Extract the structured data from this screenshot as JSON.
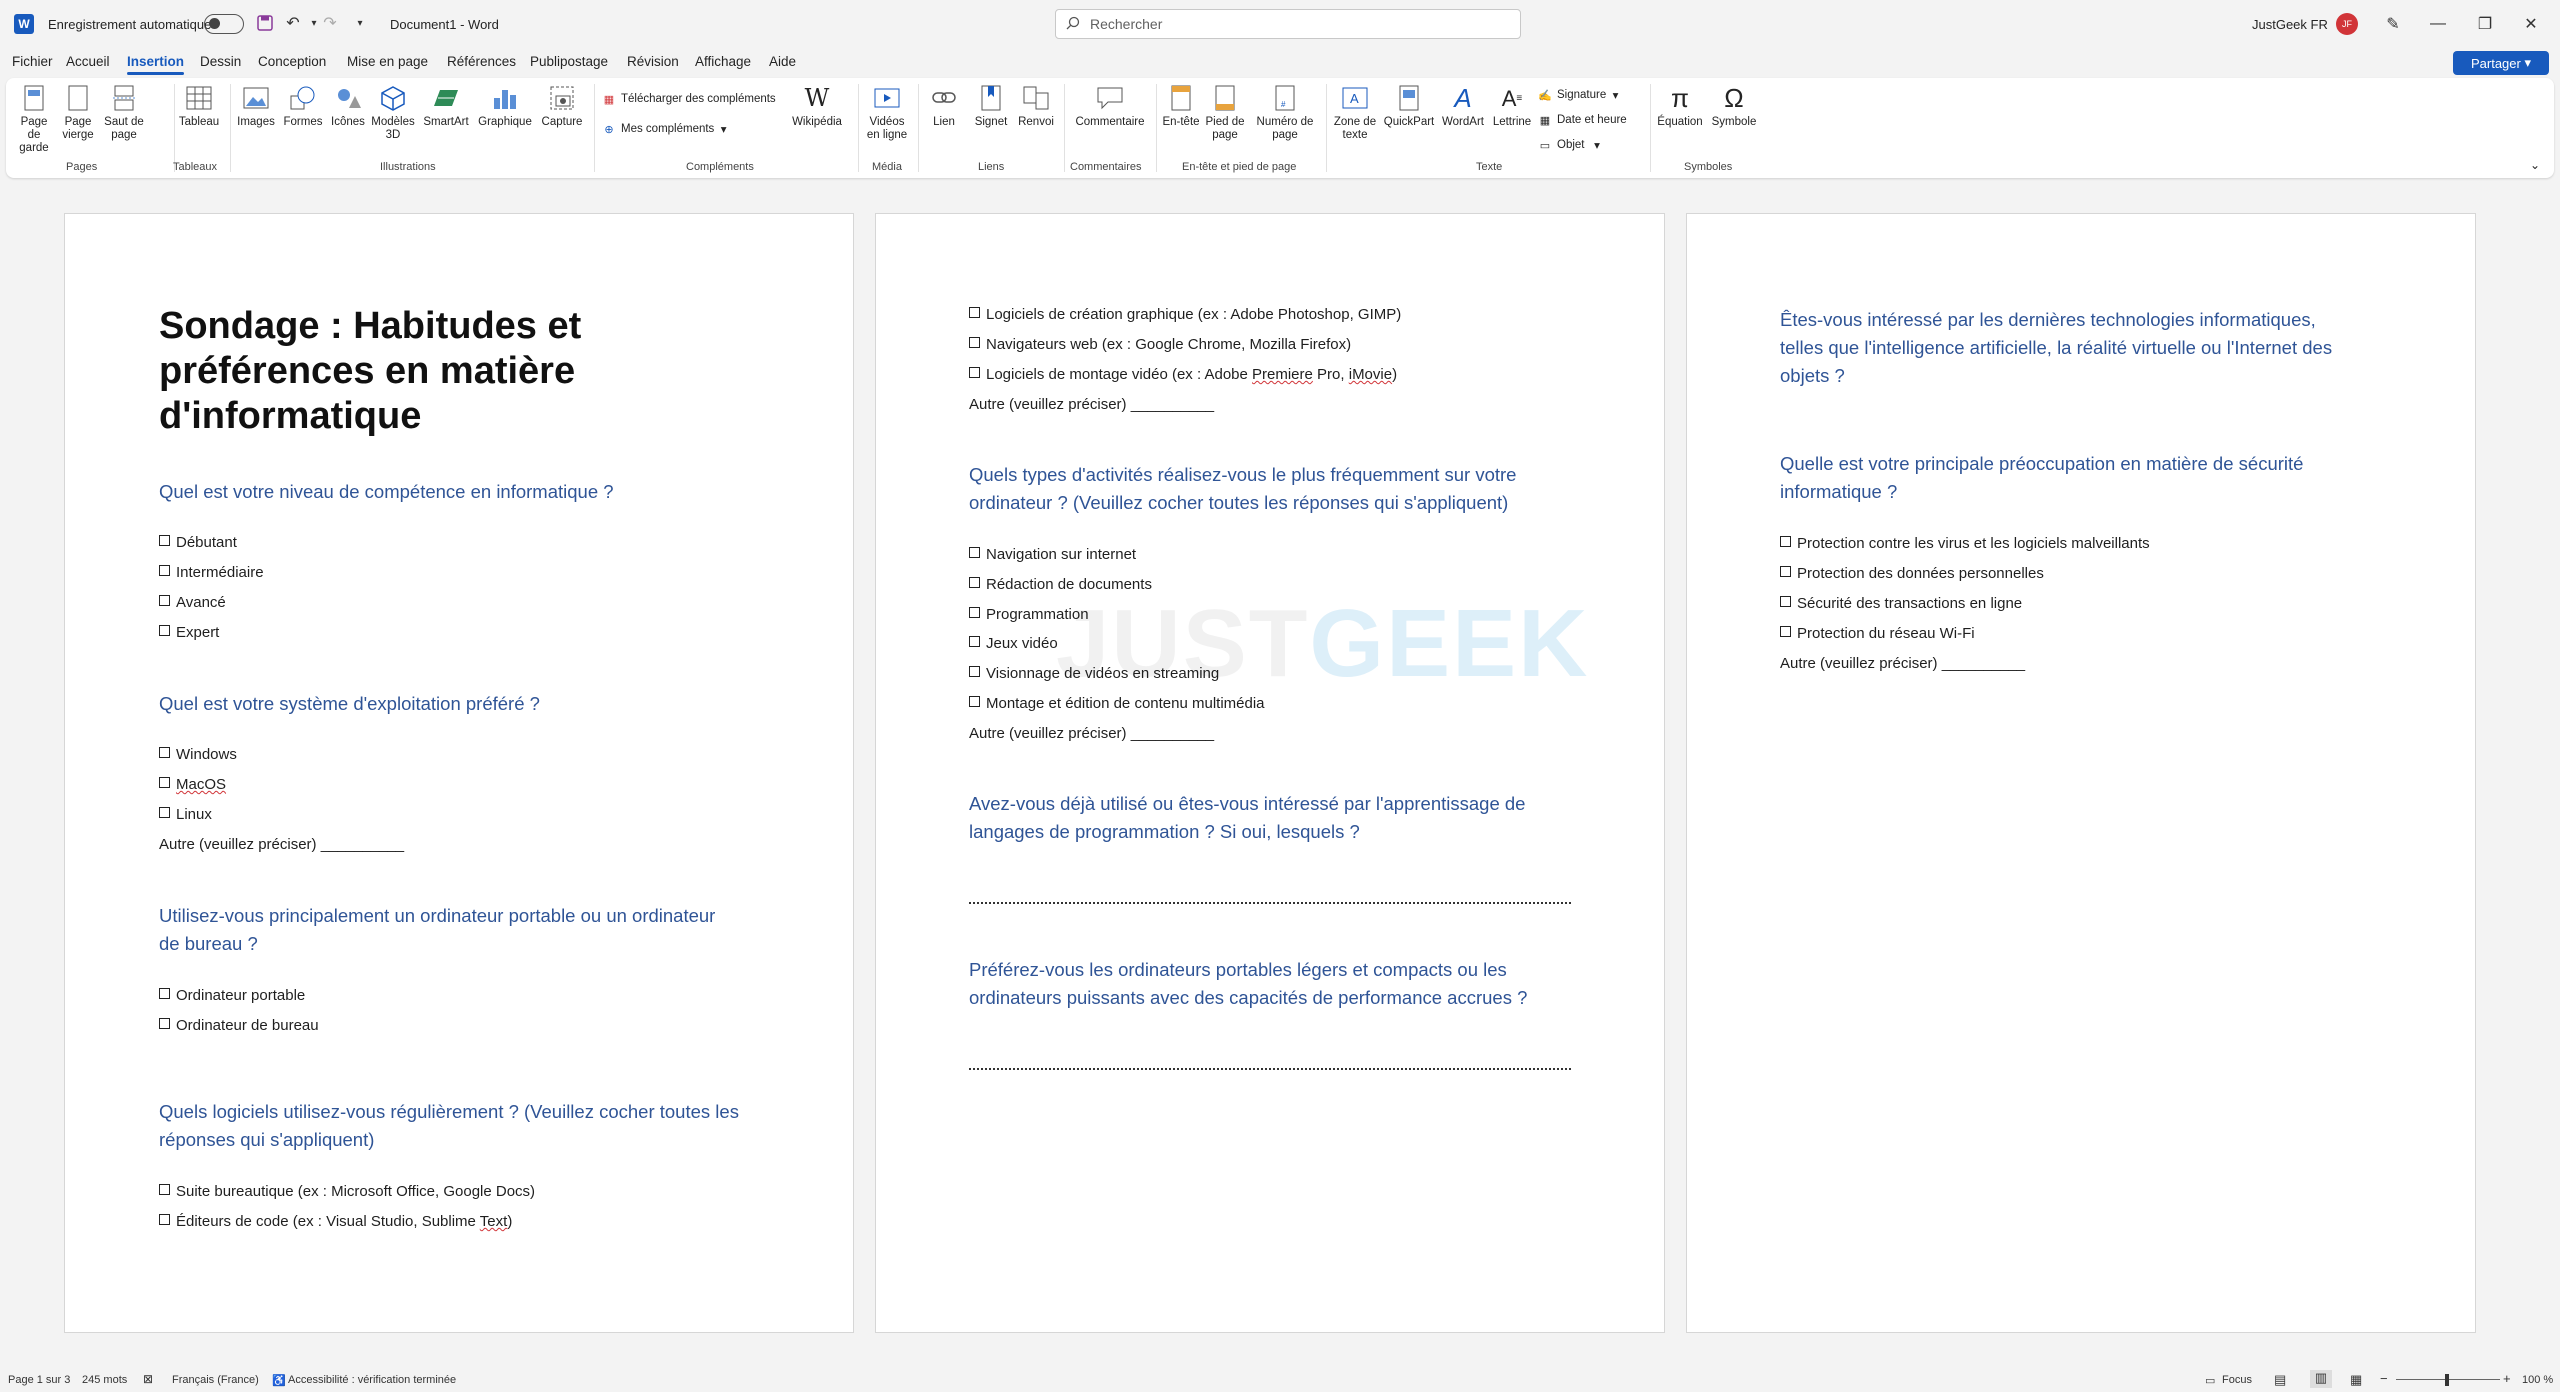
{
  "titlebar": {
    "autosave_label": "Enregistrement automatique",
    "doc_title": "Document1  -  Word",
    "search_placeholder": "Rechercher",
    "account_name": "JustGeek FR",
    "account_initials": "JF"
  },
  "menu": {
    "tabs": [
      "Fichier",
      "Accueil",
      "Insertion",
      "Dessin",
      "Conception",
      "Mise en page",
      "Références",
      "Publipostage",
      "Révision",
      "Affichage",
      "Aide"
    ],
    "active": "Insertion",
    "share_label": "Partager"
  },
  "ribbon": {
    "pages": {
      "page_de_garde": "Page de garde",
      "page_vierge": "Page vierge",
      "saut_de_page": "Saut de page",
      "group": "Pages"
    },
    "tableaux": {
      "tableau": "Tableau",
      "group": "Tableaux"
    },
    "illustrations": {
      "images": "Images",
      "formes": "Formes",
      "icones": "Icônes",
      "modeles3d": "Modèles 3D",
      "smartart": "SmartArt",
      "graphique": "Graphique",
      "capture": "Capture",
      "group": "Illustrations"
    },
    "complements": {
      "telecharger": "Télécharger des compléments",
      "mes": "Mes compléments",
      "wikipedia": "Wikipédia",
      "group": "Compléments"
    },
    "media": {
      "videos": "Vidéos en ligne",
      "group": "Média"
    },
    "liens": {
      "lien": "Lien",
      "signet": "Signet",
      "renvoi": "Renvoi",
      "group": "Liens"
    },
    "commentaires": {
      "commentaire": "Commentaire",
      "group": "Commentaires"
    },
    "entete": {
      "entete": "En-tête",
      "pied": "Pied de page",
      "numero": "Numéro de page",
      "group": "En-tête et pied de page"
    },
    "texte": {
      "zone": "Zone de texte",
      "quickpart": "QuickPart",
      "wordart": "WordArt",
      "lettrine": "Lettrine",
      "signature": "Signature",
      "date": "Date et heure",
      "objet": "Objet",
      "group": "Texte"
    },
    "symboles": {
      "equation": "Équation",
      "symbole": "Symbole",
      "group": "Symboles"
    }
  },
  "page1": {
    "title_l1": "Sondage : Habitudes et",
    "title_l2": "préférences en matière",
    "title_l3": "d'informatique",
    "q1": "Quel est votre niveau de compétence en informatique ?",
    "q1_opts": [
      "Débutant",
      "Intermédiaire",
      "Avancé",
      "Expert"
    ],
    "q2": "Quel est votre système d'exploitation préféré ?",
    "q2_opts": [
      "Windows",
      "MacOS",
      "Linux"
    ],
    "q2_other": "Autre (veuillez préciser) __________",
    "q3_l1": "Utilisez-vous principalement un ordinateur portable ou un ordinateur",
    "q3_l2": "de bureau ?",
    "q3_opts": [
      "Ordinateur portable",
      "Ordinateur de bureau"
    ],
    "q4_l1": "Quels logiciels utilisez-vous régulièrement ? (Veuillez cocher toutes les",
    "q4_l2": "réponses qui s'appliquent)",
    "q4_opt1": "Suite bureautique (ex : Microsoft Office, Google Docs)",
    "q4_opt2_a": "Éditeurs de code (ex : Visual Studio, Sublime ",
    "q4_opt2_b": "Text",
    "q4_opt2_c": ")"
  },
  "page2": {
    "opt1": "Logiciels de création graphique (ex : Adobe Photoshop, GIMP)",
    "opt2": "Navigateurs web (ex : Google Chrome, Mozilla Firefox)",
    "opt3_a": "Logiciels de montage vidéo (ex : Adobe ",
    "opt3_b": "Premiere",
    "opt3_c": " Pro, ",
    "opt3_d": "iMovie",
    "opt3_e": ")",
    "other1": "Autre (veuillez préciser) __________",
    "q5_l1": "Quels types d'activités réalisez-vous le plus fréquemment sur votre",
    "q5_l2": "ordinateur ? (Veuillez cocher toutes les réponses qui s'appliquent)",
    "q5_opts": [
      "Navigation sur internet",
      "Rédaction de documents",
      "Programmation",
      "Jeux vidéo",
      "Visionnage de vidéos en streaming",
      "Montage et édition de contenu multimédia"
    ],
    "other2": "Autre (veuillez préciser) __________",
    "q6_l1": "Avez-vous déjà utilisé ou êtes-vous intéressé par l'apprentissage de",
    "q6_l2": "langages de programmation ? Si oui, lesquels ?",
    "q7_l1": "Préférez-vous les ordinateurs portables légers et compacts ou les",
    "q7_l2": "ordinateurs puissants avec des capacités de performance accrues ?",
    "watermark_a": "JUST",
    "watermark_b": "GEEK"
  },
  "page3": {
    "q8_l1": "Êtes-vous intéressé par les dernières technologies informatiques,",
    "q8_l2": "telles que l'intelligence artificielle, la réalité virtuelle ou l'Internet des",
    "q8_l3": "objets ?",
    "q9_l1": "Quelle est votre principale préoccupation en matière de sécurité",
    "q9_l2": "informatique ?",
    "q9_opts": [
      "Protection contre les virus et les logiciels malveillants",
      "Protection des données personnelles",
      "Sécurité des transactions en ligne",
      "Protection du réseau Wi-Fi"
    ],
    "other": "Autre (veuillez préciser) __________"
  },
  "statusbar": {
    "page": "Page 1 sur 3",
    "words": "245 mots",
    "language": "Français (France)",
    "accessibility": "Accessibilité : vérification terminée",
    "focus": "Focus",
    "zoom": "100 %"
  },
  "colors": {
    "accent": "#185abd",
    "heading": "#2f5496",
    "avatar": "#d13438"
  }
}
